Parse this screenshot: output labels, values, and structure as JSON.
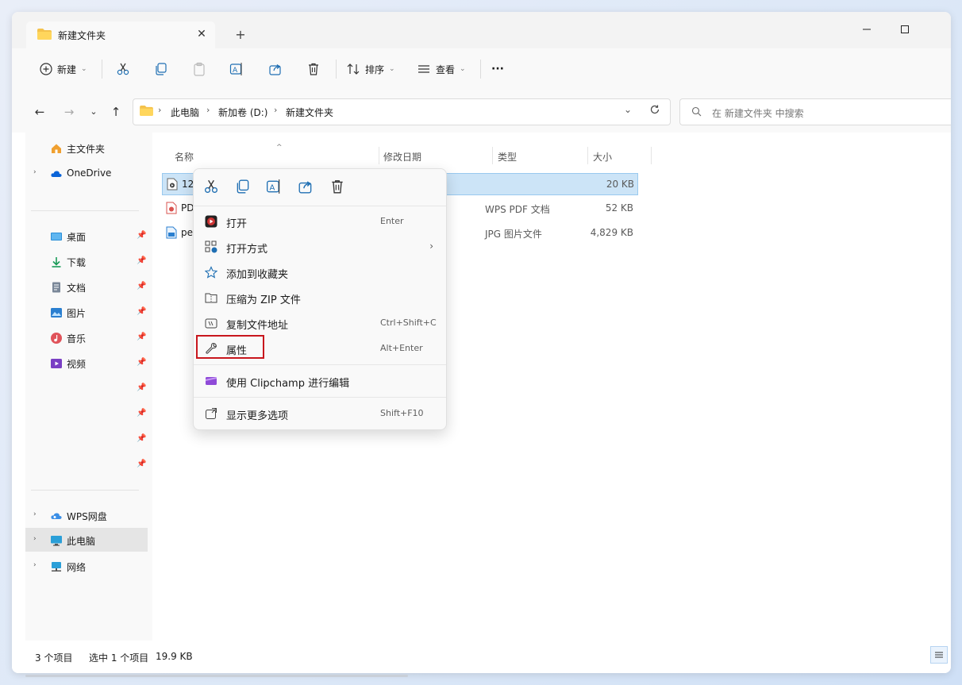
{
  "window": {
    "tab_title": "新建文件夹",
    "tab_close": "✕",
    "new_tab": "+"
  },
  "toolbar": {
    "new_label": "新建",
    "sort_label": "排序",
    "view_label": "查看",
    "more_label": "···"
  },
  "address": {
    "crumbs": [
      "此电脑",
      "新加卷 (D:)",
      "新建文件夹"
    ],
    "search_placeholder": "在 新建文件夹 中搜索"
  },
  "sidebar": {
    "quick": [
      {
        "label": "主文件夹",
        "icon": "home-icon"
      },
      {
        "label": "OneDrive",
        "icon": "cloud-icon"
      }
    ],
    "pinned": [
      {
        "label": "桌面",
        "icon": "desktop-icon"
      },
      {
        "label": "下载",
        "icon": "download-icon"
      },
      {
        "label": "文档",
        "icon": "document-icon"
      },
      {
        "label": "图片",
        "icon": "picture-icon"
      },
      {
        "label": "音乐",
        "icon": "music-icon"
      },
      {
        "label": "视频",
        "icon": "video-icon"
      }
    ],
    "drives": [
      {
        "label": "WPS网盘",
        "icon": "wps-cloud-icon"
      },
      {
        "label": "此电脑",
        "icon": "computer-icon"
      },
      {
        "label": "网络",
        "icon": "network-icon"
      }
    ]
  },
  "columns": {
    "name": "名称",
    "modified": "修改日期",
    "type": "类型",
    "size": "大小"
  },
  "files": [
    {
      "name": "12",
      "type": "",
      "size": "20 KB",
      "icon": "video-file-icon"
    },
    {
      "name": "PD",
      "type": "WPS PDF 文档",
      "size": "52 KB",
      "icon": "pdf-file-icon"
    },
    {
      "name": "pe",
      "type": "JPG 图片文件",
      "size": "4,829 KB",
      "icon": "jpg-file-icon"
    }
  ],
  "context_menu": {
    "items": [
      {
        "label": "打开",
        "shortcut": "Enter",
        "icon": "play-icon"
      },
      {
        "label": "打开方式",
        "shortcut": "",
        "icon": "open-with-icon"
      },
      {
        "label": "添加到收藏夹",
        "shortcut": "",
        "icon": "star-icon"
      },
      {
        "label": "压缩为 ZIP 文件",
        "shortcut": "",
        "icon": "zip-icon"
      },
      {
        "label": "复制文件地址",
        "shortcut": "Ctrl+Shift+C",
        "icon": "copy-path-icon"
      },
      {
        "label": "属性",
        "shortcut": "Alt+Enter",
        "icon": "wrench-icon"
      },
      {
        "label": "使用 Clipchamp 进行编辑",
        "shortcut": "",
        "icon": "clipchamp-icon"
      },
      {
        "label": "显示更多选项",
        "shortcut": "Shift+F10",
        "icon": "more-options-icon"
      }
    ]
  },
  "status": {
    "count": "3 个项目",
    "selected": "选中 1 个项目",
    "selected_size": "19.9 KB"
  },
  "colors": {
    "selection_bg": "#cce4f7",
    "highlight_border": "#c8161d",
    "accent": "#0067c0"
  }
}
